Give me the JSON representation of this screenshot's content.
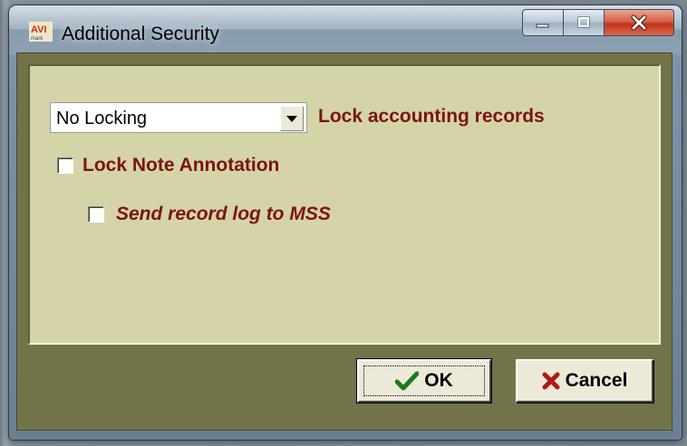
{
  "window": {
    "title": "Additional Security",
    "app_icon": "avimark-icon",
    "controls": [
      "minimize-icon",
      "maximize-icon",
      "close-icon"
    ]
  },
  "form": {
    "locking_select": {
      "value": "No Locking",
      "label": "Lock accounting records"
    },
    "lock_note_annotation": {
      "label": "Lock Note Annotation",
      "checked": false
    },
    "send_record_log": {
      "label": "Send record log to MSS",
      "checked": false
    }
  },
  "buttons": {
    "ok": {
      "label": "OK",
      "icon": "checkmark-icon"
    },
    "cancel": {
      "label": "Cancel",
      "icon": "x-icon"
    }
  },
  "colors": {
    "label_text": "#7b1414",
    "panel_bg": "#d4d4a7",
    "client_bg": "#737349"
  }
}
